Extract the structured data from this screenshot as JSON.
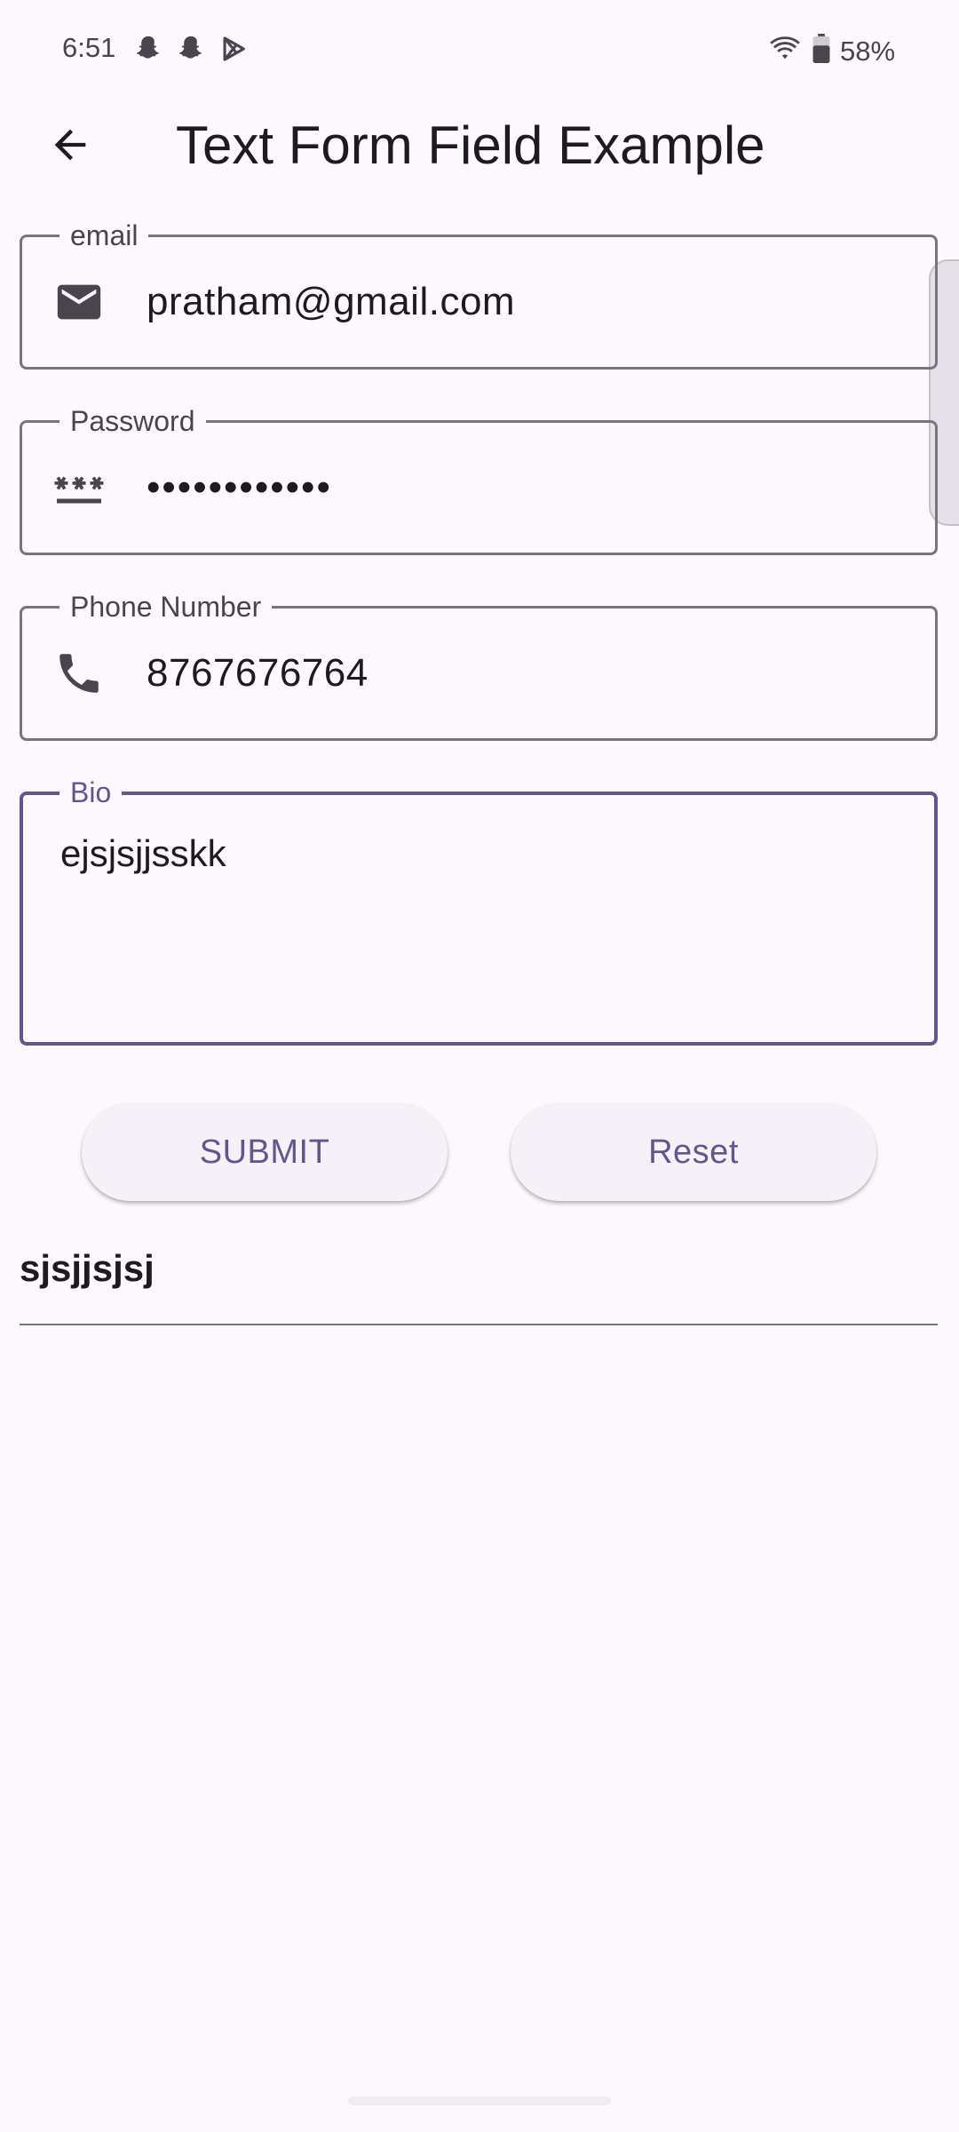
{
  "status_bar": {
    "time": "6:51",
    "notification_icons": [
      "snapchat-icon",
      "snapchat-icon",
      "play-store-icon"
    ],
    "wifi_icon": "wifi-icon",
    "battery_icon": "battery-icon",
    "battery_percent": "58%"
  },
  "app_bar": {
    "back_icon": "arrow-back-icon",
    "title": "Text Form Field Example"
  },
  "form": {
    "email": {
      "label": "email",
      "value": "pratham@gmail.com",
      "icon": "mail-icon"
    },
    "password": {
      "label": "Password",
      "value": "••••••••••••",
      "icon": "password-icon"
    },
    "phone": {
      "label": "Phone Number",
      "value": "8767676764",
      "icon": "phone-icon"
    },
    "bio": {
      "label": "Bio",
      "value": "ejsjsjjsskk"
    }
  },
  "buttons": {
    "submit_label": "SUBMIT",
    "reset_label": "Reset"
  },
  "result": {
    "text": "sjsjjsjsj"
  },
  "colors": {
    "background": "#fdf7fe",
    "accent": "#65558f",
    "outline": "#79747e",
    "text": "#1d1b20",
    "button_bg": "#f6f1f9"
  }
}
